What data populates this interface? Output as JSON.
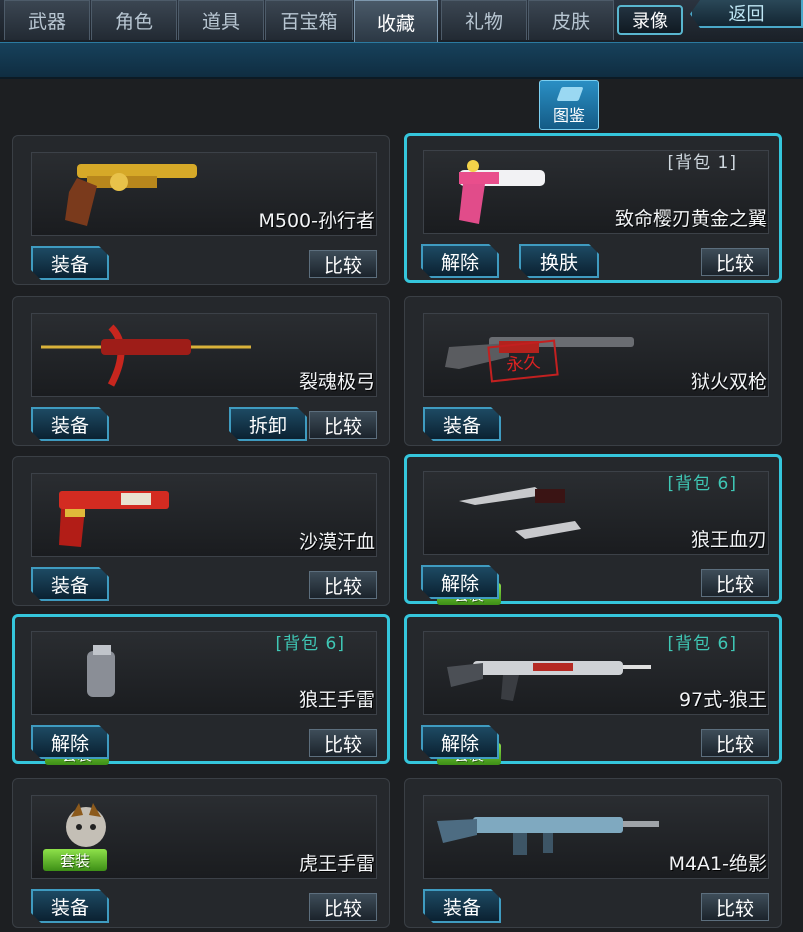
{
  "tabs": [
    {
      "label": "武器",
      "active": false
    },
    {
      "label": "角色",
      "active": false
    },
    {
      "label": "道具",
      "active": false
    },
    {
      "label": "百宝箱",
      "active": false
    },
    {
      "label": "收藏",
      "active": true
    },
    {
      "label": "礼物",
      "active": false
    },
    {
      "label": "皮肤",
      "active": false
    }
  ],
  "header": {
    "record_label": "录像",
    "back_label": "返回",
    "catalog_label": "图鉴"
  },
  "colors": {
    "highlight": "#35c6dc",
    "suit_green": "#6cc430",
    "bag_teal": "#3fc7b5"
  },
  "items": [
    {
      "name": "M500-孙行者",
      "bag": "",
      "suit": "",
      "actions": [
        "装备"
      ],
      "compare": "比较",
      "highlighted": false
    },
    {
      "name": "致命樱刃黄金之翼",
      "bag": "[背包 1]",
      "suit": "",
      "actions": [
        "解除",
        "换肤"
      ],
      "compare": "比较",
      "highlighted": true
    },
    {
      "name": "裂魂极弓",
      "bag": "",
      "suit": "",
      "actions": [
        "装备",
        "拆卸"
      ],
      "compare": "比较",
      "highlighted": false
    },
    {
      "name": "狱火双枪",
      "bag": "",
      "suit": "",
      "actions": [
        "装备"
      ],
      "compare": "",
      "highlighted": false,
      "stamp": "永久"
    },
    {
      "name": "沙漠汗血",
      "bag": "",
      "suit": "",
      "actions": [
        "装备"
      ],
      "compare": "比较",
      "highlighted": false
    },
    {
      "name": "狼王血刃",
      "bag": "[背包 6]",
      "suit": "套装",
      "actions": [
        "解除"
      ],
      "compare": "比较",
      "highlighted": true
    },
    {
      "name": "狼王手雷",
      "bag": "[背包 6]",
      "suit": "套装",
      "actions": [
        "解除"
      ],
      "compare": "比较",
      "highlighted": true
    },
    {
      "name": "97式-狼王",
      "bag": "[背包 6]",
      "suit": "套装",
      "actions": [
        "解除"
      ],
      "compare": "比较",
      "highlighted": true
    },
    {
      "name": "虎王手雷",
      "bag": "",
      "suit": "套装",
      "actions": [
        "装备"
      ],
      "compare": "比较",
      "highlighted": false
    },
    {
      "name": "M4A1-绝影",
      "bag": "",
      "suit": "",
      "actions": [
        "装备"
      ],
      "compare": "比较",
      "highlighted": false
    }
  ]
}
